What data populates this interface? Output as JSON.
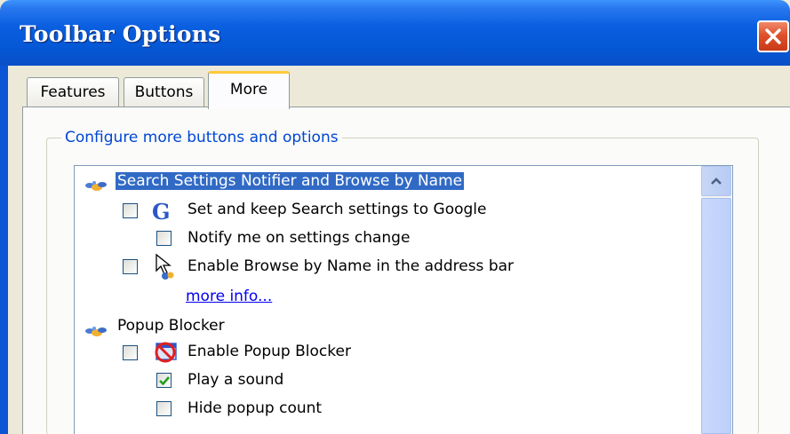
{
  "window": {
    "title": "Toolbar Options"
  },
  "tabs": [
    {
      "label": "Features"
    },
    {
      "label": "Buttons"
    },
    {
      "label": "More"
    }
  ],
  "group": {
    "legend": "Configure more buttons and options"
  },
  "tree": {
    "search_group": {
      "label": "Search Settings Notifier and Browse by Name",
      "set_search": {
        "label": "Set and keep Search settings to Google",
        "checked": false
      },
      "notify": {
        "label": "Notify me on settings change",
        "checked": false
      },
      "browse_by_name": {
        "label": "Enable Browse by Name in the address bar",
        "checked": false
      },
      "more_info": "more info..."
    },
    "popup_group": {
      "label": "Popup Blocker",
      "enable": {
        "label": "Enable Popup Blocker",
        "checked": false
      },
      "play_sound": {
        "label": "Play a sound",
        "checked": true
      },
      "hide_count": {
        "label": "Hide popup count",
        "checked": false
      }
    }
  },
  "colors": {
    "title_bar": "#0558d6",
    "selection": "#316ac5",
    "link": "#0000ee",
    "tab_highlight": "#ffc83c"
  }
}
